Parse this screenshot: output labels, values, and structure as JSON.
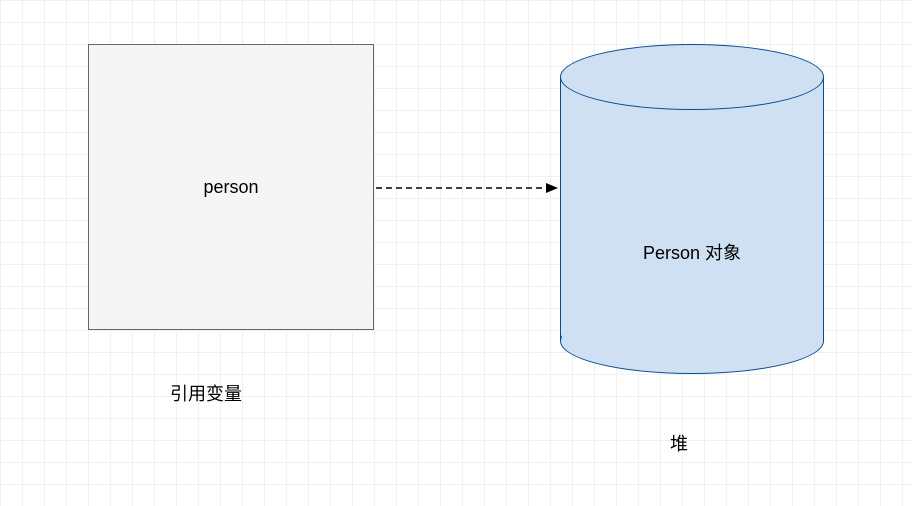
{
  "diagram": {
    "reference_box": {
      "label": "person"
    },
    "heap_cylinder": {
      "label": "Person 对象"
    },
    "labels": {
      "reference_variable": "引用变量",
      "heap": "堆"
    },
    "arrow": {
      "from": "reference_box",
      "to": "heap_cylinder",
      "style": "dashed"
    }
  }
}
